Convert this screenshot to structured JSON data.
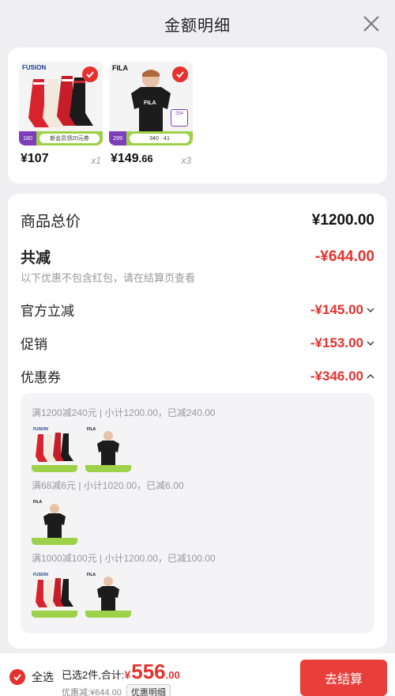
{
  "header": {
    "title": "金额明细"
  },
  "products": [
    {
      "brand": "FUSION",
      "price_main": "¥107",
      "price_small": "",
      "qty": "x1",
      "promo_left": "180",
      "promo_right": "新会员领20元券"
    },
    {
      "brand": "FILA",
      "price_main": "¥149",
      "price_small": ".66",
      "qty": "x3",
      "promo_left": "299",
      "promo_right": "340 · 41",
      "side_tag": "254"
    }
  ],
  "detail": {
    "total_label": "商品总价",
    "total_value": "¥1200.00",
    "discount_label": "共减",
    "discount_value": "-¥644.00",
    "note": "以下优惠不包含红包，请在结算页查看",
    "official_label": "官方立减",
    "official_value": "-¥145.00",
    "promo_label": "促销",
    "promo_value": "-¥153.00",
    "coupon_label": "优惠券",
    "coupon_value": "-¥346.00"
  },
  "coupons": [
    {
      "title": "满1200减240元 | 小计1200.00，已减240.00",
      "mini_labels": [
        "FUSION",
        "FILA"
      ]
    },
    {
      "title": "满68减6元 | 小计1020.00，已减6.00",
      "mini_labels": [
        "FILA"
      ]
    },
    {
      "title": "满1000减100元 | 小计1200.00，已减100.00",
      "mini_labels": [
        "FUSION",
        "FILA"
      ]
    }
  ],
  "footer": {
    "select_all": "全选",
    "selected_text": "已选2件,合计:",
    "yen": "¥",
    "total_int": "556",
    "total_dec": ".00",
    "discount_text": "优惠减:¥644.00",
    "detail_pill": "优惠明细",
    "checkout": "去结算"
  },
  "colors": {
    "accent": "#e5322d",
    "checkout_bg": "#e93f3b",
    "promo_green": "#9ed14a",
    "promo_purple": "#7c3fb8"
  }
}
